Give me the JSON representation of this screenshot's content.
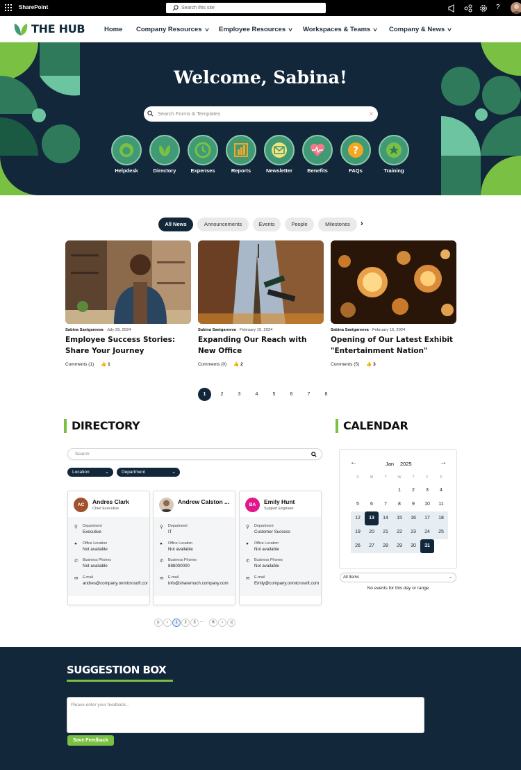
{
  "suite": {
    "app_name": "SharePoint",
    "search_placeholder": "Search this site"
  },
  "nav": {
    "logo_text": "THE HUB",
    "items": [
      {
        "label": "Home"
      },
      {
        "label": "Company Resources"
      },
      {
        "label": "Employee Resources"
      },
      {
        "label": "Workspaces & Teams"
      },
      {
        "label": "Company & News"
      }
    ]
  },
  "hero": {
    "welcome": "Welcome, Sabina!",
    "search_placeholder": "Search Forms & Templates",
    "quick_links": [
      {
        "label": "Helpdesk",
        "icon": "helpdesk-icon"
      },
      {
        "label": "Directory",
        "icon": "directory-icon"
      },
      {
        "label": "Expenses",
        "icon": "expenses-icon"
      },
      {
        "label": "Reports",
        "icon": "reports-icon"
      },
      {
        "label": "Newsletter",
        "icon": "newsletter-icon"
      },
      {
        "label": "Benefits",
        "icon": "benefits-icon"
      },
      {
        "label": "FAQs",
        "icon": "faqs-icon"
      },
      {
        "label": "Training",
        "icon": "training-icon"
      }
    ]
  },
  "news": {
    "tabs": [
      "All News",
      "Announcements",
      "Events",
      "People",
      "Milestones"
    ],
    "active_tab": "All News",
    "cards": [
      {
        "author": "Sabina Saetgareeva",
        "date": "July 29, 2024",
        "title": "Employee Success Stories: Share Your Journey",
        "comments": "Comments (1)",
        "likes": "1"
      },
      {
        "author": "Sabina Saetgareeva",
        "date": "February 15, 2024",
        "title": "Expanding Our Reach with New Office",
        "comments": "Comments (0)",
        "likes": "2"
      },
      {
        "author": "Sabina Saetgareeva",
        "date": "February 15, 2024",
        "title": "Opening of Our Latest Exhibit \"Entertainment Nation\"",
        "comments": "Comments (5)",
        "likes": "3"
      }
    ],
    "pages": [
      "1",
      "2",
      "3",
      "4",
      "5",
      "6",
      "7",
      "8"
    ],
    "current_page": "1"
  },
  "directory": {
    "title": "DIRECTORY",
    "search_placeholder": "Search",
    "filters": [
      "Location",
      "Department"
    ],
    "field_labels": {
      "department": "Department",
      "office": "Office Location",
      "phone": "Business Phones",
      "email": "E-mail"
    },
    "people": [
      {
        "initials": "AC",
        "name": "Andres Clark",
        "job": "Chief Executive",
        "department": "Executive",
        "office": "Not available",
        "phone": "Not available",
        "email": "andres@company.onmicrosoft.com",
        "color": "#a0522d"
      },
      {
        "initials": "",
        "name": "Andrew Calston ...",
        "job": "",
        "department": "IT",
        "office": "Not available",
        "phone": "888000000",
        "email": "info@sharemuch.company.com",
        "color": "#5a4a3a"
      },
      {
        "initials": "BA",
        "name": "Emily Hunt",
        "job": "Support Engineer",
        "department": "Customer Success",
        "office": "Not available",
        "phone": "Not available",
        "email": "Emily@company.onmicrosoft.com",
        "color": "#e0188a"
      }
    ],
    "pager": [
      "1",
      "2",
      "3",
      "...",
      "6"
    ]
  },
  "calendar": {
    "title": "CALENDAR",
    "month": "Jan",
    "year": "2025",
    "weekdays": [
      "S",
      "M",
      "T",
      "W",
      "T",
      "F",
      "S"
    ],
    "weeks": [
      [
        "",
        "",
        "",
        "1",
        "2",
        "3",
        "4"
      ],
      [
        "5",
        "6",
        "7",
        "8",
        "9",
        "10",
        "11"
      ],
      [
        "12",
        "13",
        "14",
        "15",
        "16",
        "17",
        "18"
      ],
      [
        "19",
        "20",
        "21",
        "22",
        "23",
        "24",
        "25"
      ],
      [
        "26",
        "27",
        "28",
        "29",
        "30",
        "31",
        ""
      ]
    ],
    "selected": [
      "13",
      "31"
    ],
    "filter": "All Items",
    "empty_text": "No events for this day or range"
  },
  "suggestion": {
    "title": "SUGGESTION BOX",
    "placeholder": "Please enter your feedback...",
    "button": "Save Feedback"
  },
  "colors": {
    "navy": "#12273a",
    "green": "#7ac143",
    "teal": "#3f9a75"
  }
}
